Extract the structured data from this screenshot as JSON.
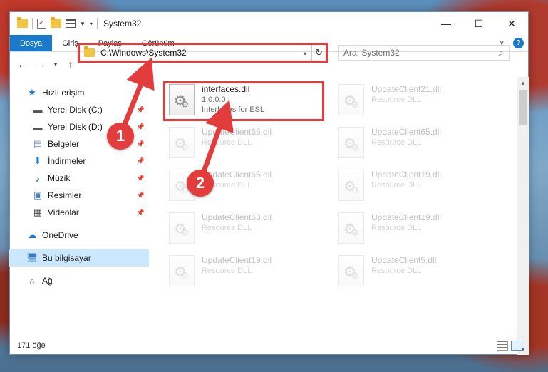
{
  "window": {
    "title": "System32",
    "controls": {
      "minimize": "—",
      "maximize": "☐",
      "close": "✕"
    }
  },
  "ribbon": {
    "tabs": [
      "Dosya",
      "Giriş",
      "Paylaş",
      "Görünüm"
    ],
    "help": "?"
  },
  "nav": {
    "address": "C:\\Windows\\System32",
    "search_placeholder": "Ara: System32"
  },
  "sidebar": {
    "items": [
      {
        "label": "Hızlı erişim",
        "icon": "star-icon",
        "pinned": false
      },
      {
        "label": "Yerel Disk (C:)",
        "icon": "drive-icon",
        "pinned": true
      },
      {
        "label": "Yerel Disk (D:)",
        "icon": "drive-icon",
        "pinned": true
      },
      {
        "label": "Belgeler",
        "icon": "documents-icon",
        "pinned": true
      },
      {
        "label": "İndirmeler",
        "icon": "downloads-icon",
        "pinned": true
      },
      {
        "label": "Müzik",
        "icon": "music-icon",
        "pinned": true
      },
      {
        "label": "Resimler",
        "icon": "pictures-icon",
        "pinned": true
      },
      {
        "label": "Videolar",
        "icon": "videos-icon",
        "pinned": true
      },
      {
        "label": "OneDrive",
        "icon": "cloud-icon",
        "pinned": false
      },
      {
        "label": "Bu bilgisayar",
        "icon": "computer-icon",
        "pinned": false,
        "selected": true
      },
      {
        "label": "Ağ",
        "icon": "network-icon",
        "pinned": false
      }
    ]
  },
  "files": {
    "highlighted": {
      "name": "interfaces.dll",
      "version": "1.0.0.0",
      "description": "Interfaces for ESL"
    },
    "faded_left": [
      {
        "name": "UpdateClient65.dll",
        "description": "Resource DLL"
      },
      {
        "name": "UpdateClient65.dll",
        "description": "Resource DLL"
      },
      {
        "name": "UpdateClient63.dll",
        "description": "Resource DLL"
      },
      {
        "name": "UpdateClient19.dll",
        "description": "Resource DLL"
      }
    ],
    "faded_right": [
      {
        "name": "UpdateClient21.dll",
        "description": "Resource DLL"
      },
      {
        "name": "UpdateClient65.dll",
        "description": "Resource DLL"
      },
      {
        "name": "UpdateClient19.dll",
        "description": "Resource DLL"
      },
      {
        "name": "UpdateClient19.dll",
        "description": "Resource DLL"
      },
      {
        "name": "UpdateClient5.dll",
        "description": "Resource DLL"
      }
    ]
  },
  "status": {
    "count": "171 öğe"
  },
  "annotations": {
    "step1": "1",
    "step2": "2",
    "color": "#e23c3c"
  }
}
